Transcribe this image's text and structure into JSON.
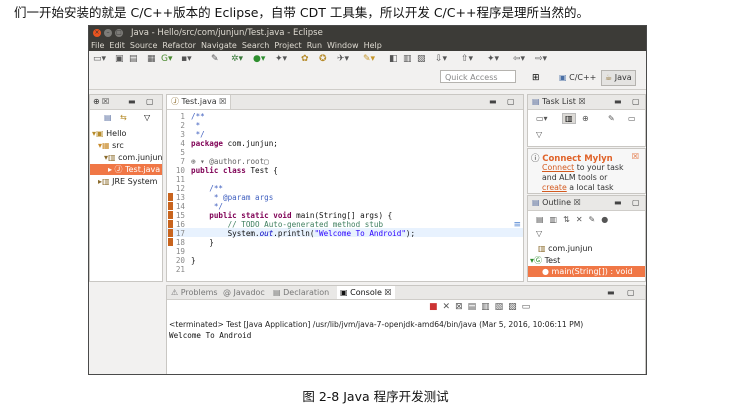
{
  "caption_top": "们一开始安装的就是 C/C++版本的 Eclipse，自带 CDT 工具集，所以开发 C/C++程序是理所当然的。",
  "caption_bottom": "图 2-8 Java 程序开发测试",
  "window": {
    "title": "Java - Hello/src/com/junjun/Test.java - Eclipse"
  },
  "menu": [
    "File",
    "Edit",
    "Source",
    "Refactor",
    "Navigate",
    "Search",
    "Project",
    "Run",
    "Window",
    "Help"
  ],
  "quick_access": {
    "placeholder": "Quick Access"
  },
  "perspectives": {
    "cpp": "C/C++",
    "java": "Java"
  },
  "explorer": {
    "items": [
      {
        "label": "Hello"
      },
      {
        "label": "src"
      },
      {
        "label": "com.junjun"
      },
      {
        "label": "Test.java"
      },
      {
        "label": "JRE System"
      }
    ]
  },
  "editor": {
    "tab": "Test.java",
    "lines": [
      {
        "n": "1",
        "text": "/**"
      },
      {
        "n": "2",
        "text": " *"
      },
      {
        "n": "3",
        "text": " */"
      },
      {
        "n": "4",
        "kw": "package",
        "text": " com.junjun;"
      },
      {
        "n": "5",
        "text": ""
      },
      {
        "n": "7",
        "text": "@author.root"
      },
      {
        "n": "10",
        "kw": "public class",
        "text": " Test {"
      },
      {
        "n": "11",
        "text": ""
      },
      {
        "n": "12",
        "text": "    /**"
      },
      {
        "n": "13",
        "text": "     * @param args"
      },
      {
        "n": "14",
        "text": "     */"
      },
      {
        "n": "15",
        "kw": "    public static void",
        "text": " main(String[] args) {"
      },
      {
        "n": "16",
        "text": "        // TODO Auto-generated method stub"
      },
      {
        "n": "17",
        "pre": "        System.",
        "fld": "out",
        "post": ".println(",
        "str": "\"Welcome To Android\"",
        "end": ");"
      },
      {
        "n": "18",
        "text": "    }"
      },
      {
        "n": "19",
        "text": ""
      },
      {
        "n": "20",
        "text": "}"
      },
      {
        "n": "21",
        "text": ""
      }
    ]
  },
  "bottom_tabs": {
    "problems": "Problems",
    "javadoc": "Javadoc",
    "declaration": "Declaration",
    "console": "Console"
  },
  "console": {
    "terminated": "<terminated> Test [Java Application] /usr/lib/jvm/java-7-openjdk-amd64/bin/java (Mar 5, 2016, 10:06:11 PM)",
    "output": "Welcome To Android"
  },
  "task_list": {
    "title": "Task List",
    "mylyn_title": "Connect Mylyn",
    "mylyn_link": "Connect",
    "mylyn_rest": " to your task",
    "mylyn_line2": "and ALM tools or",
    "mylyn_link2": "create",
    "mylyn_rest2": " a local task"
  },
  "outline": {
    "title": "Outline",
    "items": [
      {
        "label": "com.junjun"
      },
      {
        "label": "Test"
      },
      {
        "label": "main(String[]) : void"
      }
    ]
  },
  "colors": {
    "accent": "#f07746",
    "titlebar": "#3c3b37",
    "keyword": "#7f0055",
    "string": "#2a00ff"
  }
}
